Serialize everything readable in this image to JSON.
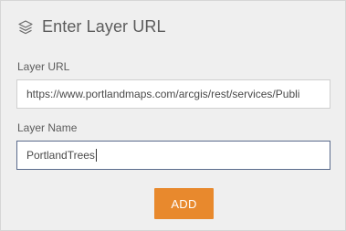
{
  "header": {
    "title": "Enter Layer URL",
    "icon": "layers-icon"
  },
  "form": {
    "url_label": "Layer URL",
    "url_value": "https://www.portlandmaps.com/arcgis/rest/services/Publi",
    "name_label": "Layer Name",
    "name_value": "PortlandTrees"
  },
  "actions": {
    "add_label": "ADD"
  },
  "colors": {
    "accent": "#e8892d",
    "panel_bg": "#efefef",
    "focus_border": "#5a6b8c"
  }
}
